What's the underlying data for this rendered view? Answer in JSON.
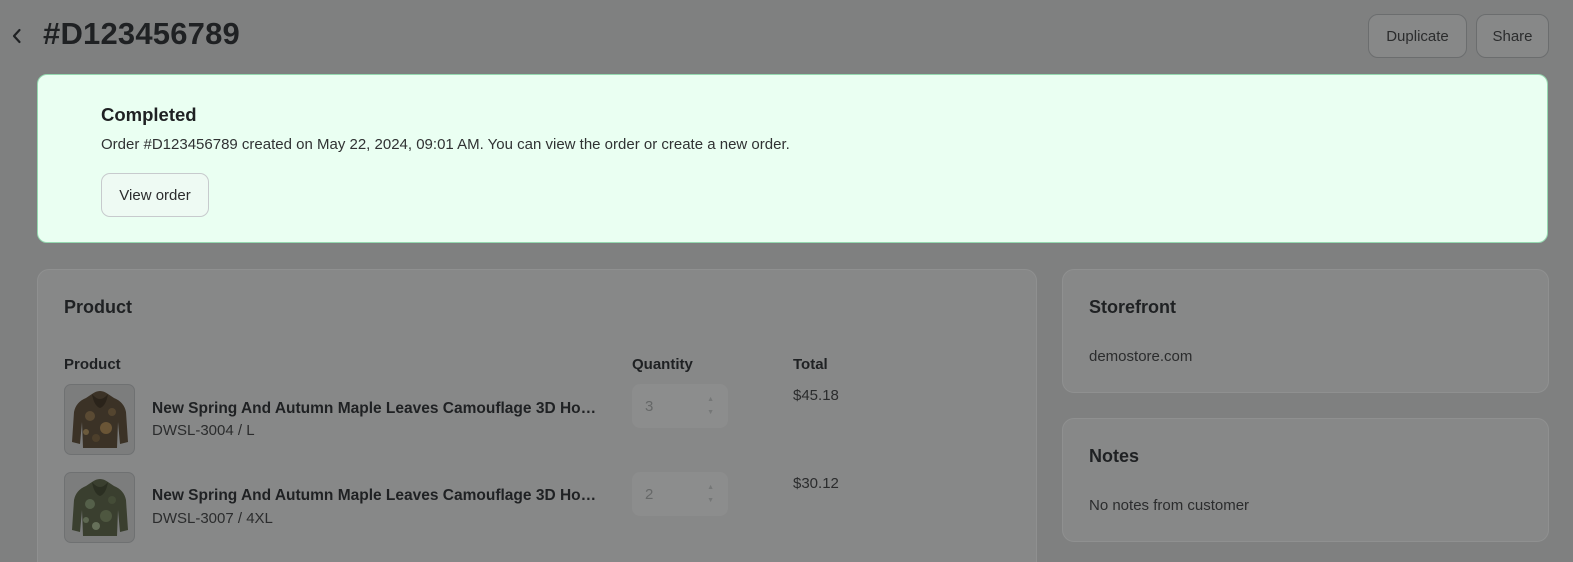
{
  "header": {
    "title": "#D123456789",
    "duplicate_label": "Duplicate",
    "share_label": "Share"
  },
  "banner": {
    "title": "Completed",
    "message": "Order #D123456789 created on May 22, 2024, 09:01 AM. You can view the order or create a new order.",
    "button_label": "View order",
    "background_color": "#eafff2",
    "border_color": "#95d9b0"
  },
  "product_card": {
    "title": "Product",
    "columns": [
      "Product",
      "Quantity",
      "Total"
    ],
    "rows": [
      {
        "name": "New Spring And Autumn Maple Leaves Camouflage 3D Hoo...",
        "sku": "DWSL-3004 / L",
        "quantity": "3",
        "total": "$45.18"
      },
      {
        "name": "New Spring And Autumn Maple Leaves Camouflage 3D Hoo...",
        "sku": "DWSL-3007 / 4XL",
        "quantity": "2",
        "total": "$30.12"
      }
    ]
  },
  "storefront": {
    "title": "Storefront",
    "value": "demostore.com"
  },
  "notes": {
    "title": "Notes",
    "value": "No notes from customer"
  },
  "icons": {
    "back": "chevron-left-icon",
    "product_image": "hoodie-image"
  }
}
